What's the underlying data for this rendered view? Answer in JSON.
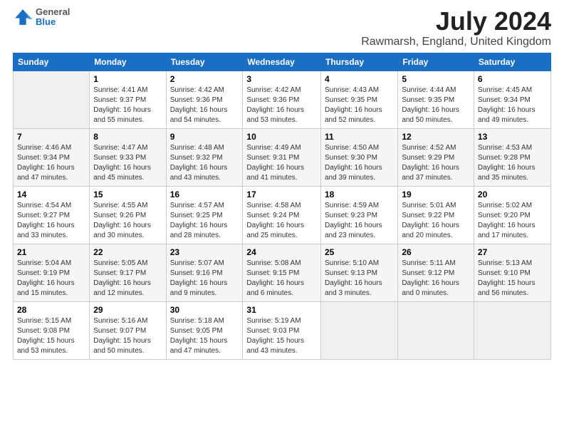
{
  "logo": {
    "general": "General",
    "blue": "Blue"
  },
  "header": {
    "title": "July 2024",
    "subtitle": "Rawmarsh, England, United Kingdom"
  },
  "days": [
    "Sunday",
    "Monday",
    "Tuesday",
    "Wednesday",
    "Thursday",
    "Friday",
    "Saturday"
  ],
  "weeks": [
    [
      {
        "date": "",
        "info": ""
      },
      {
        "date": "1",
        "info": "Sunrise: 4:41 AM\nSunset: 9:37 PM\nDaylight: 16 hours\nand 55 minutes."
      },
      {
        "date": "2",
        "info": "Sunrise: 4:42 AM\nSunset: 9:36 PM\nDaylight: 16 hours\nand 54 minutes."
      },
      {
        "date": "3",
        "info": "Sunrise: 4:42 AM\nSunset: 9:36 PM\nDaylight: 16 hours\nand 53 minutes."
      },
      {
        "date": "4",
        "info": "Sunrise: 4:43 AM\nSunset: 9:35 PM\nDaylight: 16 hours\nand 52 minutes."
      },
      {
        "date": "5",
        "info": "Sunrise: 4:44 AM\nSunset: 9:35 PM\nDaylight: 16 hours\nand 50 minutes."
      },
      {
        "date": "6",
        "info": "Sunrise: 4:45 AM\nSunset: 9:34 PM\nDaylight: 16 hours\nand 49 minutes."
      }
    ],
    [
      {
        "date": "7",
        "info": "Sunrise: 4:46 AM\nSunset: 9:34 PM\nDaylight: 16 hours\nand 47 minutes."
      },
      {
        "date": "8",
        "info": "Sunrise: 4:47 AM\nSunset: 9:33 PM\nDaylight: 16 hours\nand 45 minutes."
      },
      {
        "date": "9",
        "info": "Sunrise: 4:48 AM\nSunset: 9:32 PM\nDaylight: 16 hours\nand 43 minutes."
      },
      {
        "date": "10",
        "info": "Sunrise: 4:49 AM\nSunset: 9:31 PM\nDaylight: 16 hours\nand 41 minutes."
      },
      {
        "date": "11",
        "info": "Sunrise: 4:50 AM\nSunset: 9:30 PM\nDaylight: 16 hours\nand 39 minutes."
      },
      {
        "date": "12",
        "info": "Sunrise: 4:52 AM\nSunset: 9:29 PM\nDaylight: 16 hours\nand 37 minutes."
      },
      {
        "date": "13",
        "info": "Sunrise: 4:53 AM\nSunset: 9:28 PM\nDaylight: 16 hours\nand 35 minutes."
      }
    ],
    [
      {
        "date": "14",
        "info": "Sunrise: 4:54 AM\nSunset: 9:27 PM\nDaylight: 16 hours\nand 33 minutes."
      },
      {
        "date": "15",
        "info": "Sunrise: 4:55 AM\nSunset: 9:26 PM\nDaylight: 16 hours\nand 30 minutes."
      },
      {
        "date": "16",
        "info": "Sunrise: 4:57 AM\nSunset: 9:25 PM\nDaylight: 16 hours\nand 28 minutes."
      },
      {
        "date": "17",
        "info": "Sunrise: 4:58 AM\nSunset: 9:24 PM\nDaylight: 16 hours\nand 25 minutes."
      },
      {
        "date": "18",
        "info": "Sunrise: 4:59 AM\nSunset: 9:23 PM\nDaylight: 16 hours\nand 23 minutes."
      },
      {
        "date": "19",
        "info": "Sunrise: 5:01 AM\nSunset: 9:22 PM\nDaylight: 16 hours\nand 20 minutes."
      },
      {
        "date": "20",
        "info": "Sunrise: 5:02 AM\nSunset: 9:20 PM\nDaylight: 16 hours\nand 17 minutes."
      }
    ],
    [
      {
        "date": "21",
        "info": "Sunrise: 5:04 AM\nSunset: 9:19 PM\nDaylight: 16 hours\nand 15 minutes."
      },
      {
        "date": "22",
        "info": "Sunrise: 5:05 AM\nSunset: 9:17 PM\nDaylight: 16 hours\nand 12 minutes."
      },
      {
        "date": "23",
        "info": "Sunrise: 5:07 AM\nSunset: 9:16 PM\nDaylight: 16 hours\nand 9 minutes."
      },
      {
        "date": "24",
        "info": "Sunrise: 5:08 AM\nSunset: 9:15 PM\nDaylight: 16 hours\nand 6 minutes."
      },
      {
        "date": "25",
        "info": "Sunrise: 5:10 AM\nSunset: 9:13 PM\nDaylight: 16 hours\nand 3 minutes."
      },
      {
        "date": "26",
        "info": "Sunrise: 5:11 AM\nSunset: 9:12 PM\nDaylight: 16 hours\nand 0 minutes."
      },
      {
        "date": "27",
        "info": "Sunrise: 5:13 AM\nSunset: 9:10 PM\nDaylight: 15 hours\nand 56 minutes."
      }
    ],
    [
      {
        "date": "28",
        "info": "Sunrise: 5:15 AM\nSunset: 9:08 PM\nDaylight: 15 hours\nand 53 minutes."
      },
      {
        "date": "29",
        "info": "Sunrise: 5:16 AM\nSunset: 9:07 PM\nDaylight: 15 hours\nand 50 minutes."
      },
      {
        "date": "30",
        "info": "Sunrise: 5:18 AM\nSunset: 9:05 PM\nDaylight: 15 hours\nand 47 minutes."
      },
      {
        "date": "31",
        "info": "Sunrise: 5:19 AM\nSunset: 9:03 PM\nDaylight: 15 hours\nand 43 minutes."
      },
      {
        "date": "",
        "info": ""
      },
      {
        "date": "",
        "info": ""
      },
      {
        "date": "",
        "info": ""
      }
    ]
  ]
}
